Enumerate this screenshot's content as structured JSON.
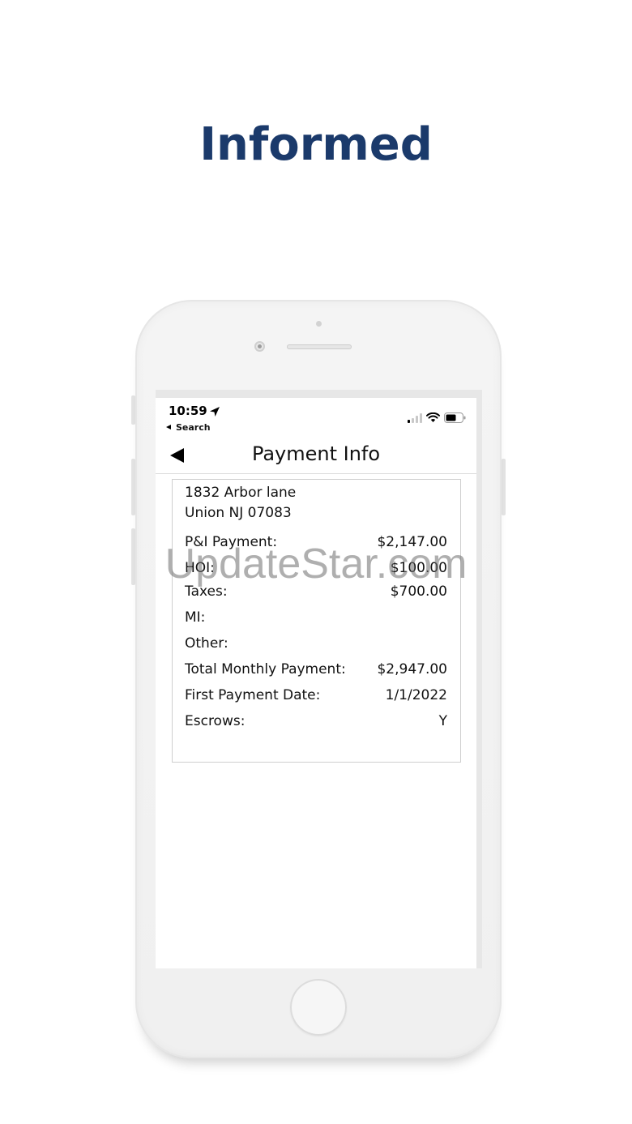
{
  "headline": {
    "text": "Informed",
    "color": "#1b3a6b"
  },
  "status_bar": {
    "time": "10:59",
    "back_label": "Search",
    "icons": [
      "location-arrow-icon",
      "signal-icon",
      "wifi-icon",
      "battery-icon"
    ]
  },
  "nav": {
    "title": "Payment Info",
    "back_icon": "back-triangle-icon"
  },
  "address": {
    "line1": "1832 Arbor lane",
    "line2": "Union NJ 07083"
  },
  "rows": [
    {
      "label": "P&I Payment:",
      "value": "$2,147.00"
    },
    {
      "label": "HOI:",
      "value": "$100.00"
    },
    {
      "label": "Taxes:",
      "value": "$700.00"
    },
    {
      "label": "MI:",
      "value": ""
    },
    {
      "label": "Other:",
      "value": ""
    },
    {
      "label": "Total Monthly Payment:",
      "value": "$2,947.00"
    },
    {
      "label": "First Payment Date:",
      "value": "1/1/2022"
    },
    {
      "label": "Escrows:",
      "value": "Y"
    }
  ],
  "watermark": {
    "text": "UpdateStar.com"
  }
}
